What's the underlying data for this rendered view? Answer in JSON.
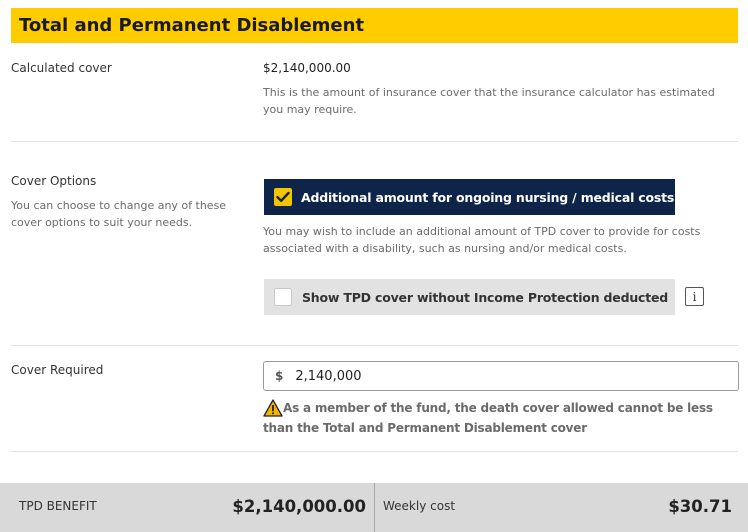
{
  "section": {
    "title": "Total and Permanent Disablement"
  },
  "calculated_cover": {
    "label": "Calculated cover",
    "value": "$2,140,000.00",
    "help": "This is the amount of insurance cover that the insurance calculator has estimated you may require."
  },
  "cover_options": {
    "label": "Cover Options",
    "description": "You can choose to change any of these cover options to suit your needs.",
    "nursing_option": {
      "label": "Additional amount for ongoing nursing / medical costs",
      "checked": true,
      "help": "You may wish to include an additional amount of TPD cover to provide for costs associated with a disability, such as nursing and/or medical costs."
    },
    "tpd_option": {
      "label": "Show TPD cover without Income Protection deducted",
      "checked": false,
      "info_icon": "info-icon",
      "info_glyph": "i"
    }
  },
  "cover_required": {
    "label": "Cover Required",
    "currency": "$",
    "value": "2,140,000",
    "warning": "As a member of the fund, the death cover allowed cannot be less than the Total and Permanent Disablement cover",
    "warning_icon": "warning-icon"
  },
  "footer": {
    "benefit_label": "TPD BENEFIT",
    "benefit_amount": "$2,140,000.00",
    "weekly_label": "Weekly cost",
    "weekly_amount": "$30.71"
  },
  "colors": {
    "accent_yellow": "#ffcc00",
    "navy": "#0f2449",
    "footer_bg": "#d9d9d9"
  }
}
